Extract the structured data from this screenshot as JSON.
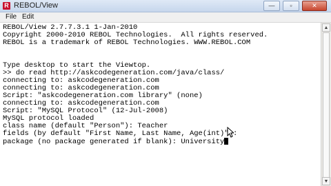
{
  "window": {
    "title": "REBOL/View",
    "icon_letter": "R"
  },
  "menu": {
    "file": "File",
    "edit": "Edit"
  },
  "controls": {
    "minimize": "—",
    "maximize": "▫",
    "close": "✕"
  },
  "console": {
    "lines": [
      "REBOL/View 2.7.7.3.1 1-Jan-2010",
      "Copyright 2000-2010 REBOL Technologies.  All rights reserved.",
      "REBOL is a trademark of REBOL Technologies. WWW.REBOL.COM",
      "",
      "",
      "Type desktop to start the Viewtop.",
      ">> do read http://askcodegeneration.com/java/class/",
      "connecting to: askcodegeneration.com",
      "connecting to: askcodegeneration.com",
      "Script: \"askcodegeneration.com library\" (none)",
      "connecting to: askcodegeneration.com",
      "Script: \"MySQL Protocol\" (12-Jul-2008)",
      "MySQL protocol loaded",
      "class name (default \"Person\"): Teacher",
      "fields (by default \"First Name, Last Name, Age(int)\"):",
      "package (no package generated if blank): University"
    ]
  }
}
